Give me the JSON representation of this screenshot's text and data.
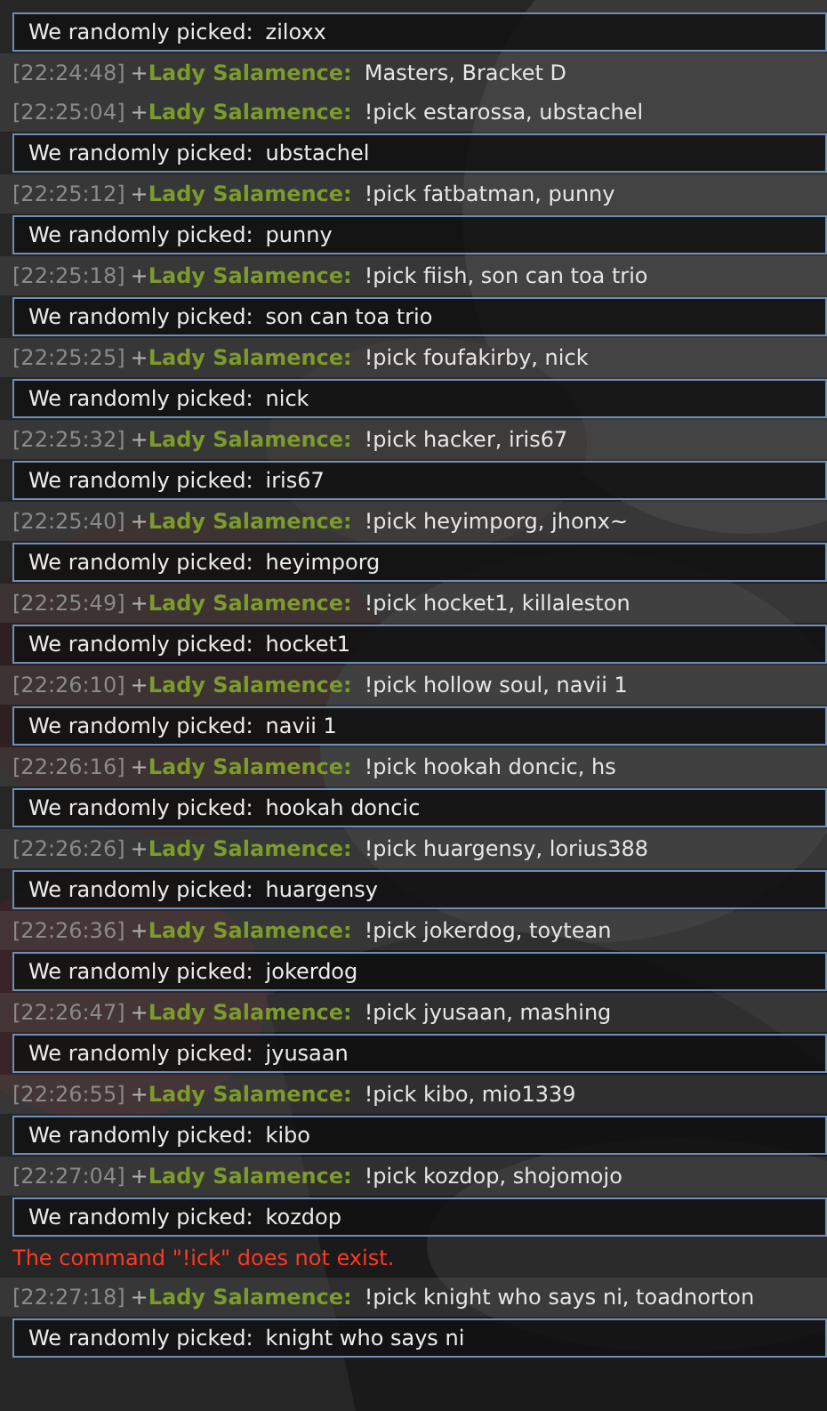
{
  "messages": [
    {
      "kind": "announcement",
      "label": "We randomly picked:",
      "value": "ziloxx"
    },
    {
      "kind": "chat",
      "time": "[22:24:48]",
      "rank": "+",
      "user": "Lady Salamence:",
      "text": "Masters, Bracket D"
    },
    {
      "kind": "chat",
      "time": "[22:25:04]",
      "rank": "+",
      "user": "Lady Salamence:",
      "text": "!pick estarossa, ubstachel"
    },
    {
      "kind": "announcement",
      "label": "We randomly picked:",
      "value": "ubstachel"
    },
    {
      "kind": "chat",
      "time": "[22:25:12]",
      "rank": "+",
      "user": "Lady Salamence:",
      "text": "!pick fatbatman, punny"
    },
    {
      "kind": "announcement",
      "label": "We randomly picked:",
      "value": "punny"
    },
    {
      "kind": "chat",
      "time": "[22:25:18]",
      "rank": "+",
      "user": "Lady Salamence:",
      "text": "!pick fiish, son can toa trio"
    },
    {
      "kind": "announcement",
      "label": "We randomly picked:",
      "value": "son can toa trio"
    },
    {
      "kind": "chat",
      "time": "[22:25:25]",
      "rank": "+",
      "user": "Lady Salamence:",
      "text": "!pick foufakirby, nick"
    },
    {
      "kind": "announcement",
      "label": "We randomly picked:",
      "value": "nick"
    },
    {
      "kind": "chat",
      "time": "[22:25:32]",
      "rank": "+",
      "user": "Lady Salamence:",
      "text": "!pick hacker, iris67"
    },
    {
      "kind": "announcement",
      "label": "We randomly picked:",
      "value": "iris67"
    },
    {
      "kind": "chat",
      "time": "[22:25:40]",
      "rank": "+",
      "user": "Lady Salamence:",
      "text": "!pick heyimporg, jhonx~"
    },
    {
      "kind": "announcement",
      "label": "We randomly picked:",
      "value": "heyimporg"
    },
    {
      "kind": "chat",
      "time": "[22:25:49]",
      "rank": "+",
      "user": "Lady Salamence:",
      "text": "!pick hocket1, killaleston"
    },
    {
      "kind": "announcement",
      "label": "We randomly picked:",
      "value": "hocket1"
    },
    {
      "kind": "chat",
      "time": "[22:26:10]",
      "rank": "+",
      "user": "Lady Salamence:",
      "text": "!pick hollow soul, navii 1"
    },
    {
      "kind": "announcement",
      "label": "We randomly picked:",
      "value": "navii 1"
    },
    {
      "kind": "chat",
      "time": "[22:26:16]",
      "rank": "+",
      "user": "Lady Salamence:",
      "text": "!pick hookah doncic, hs"
    },
    {
      "kind": "announcement",
      "label": "We randomly picked:",
      "value": "hookah doncic"
    },
    {
      "kind": "chat",
      "time": "[22:26:26]",
      "rank": "+",
      "user": "Lady Salamence:",
      "text": "!pick huargensy, lorius388"
    },
    {
      "kind": "announcement",
      "label": "We randomly picked:",
      "value": "huargensy"
    },
    {
      "kind": "chat",
      "time": "[22:26:36]",
      "rank": "+",
      "user": "Lady Salamence:",
      "text": "!pick jokerdog, toytean"
    },
    {
      "kind": "announcement",
      "label": "We randomly picked:",
      "value": "jokerdog"
    },
    {
      "kind": "chat",
      "time": "[22:26:47]",
      "rank": "+",
      "user": "Lady Salamence:",
      "text": "!pick jyusaan, mashing"
    },
    {
      "kind": "announcement",
      "label": "We randomly picked:",
      "value": "jyusaan"
    },
    {
      "kind": "chat",
      "time": "[22:26:55]",
      "rank": "+",
      "user": "Lady Salamence:",
      "text": "!pick kibo, mio1339"
    },
    {
      "kind": "announcement",
      "label": "We randomly picked:",
      "value": "kibo"
    },
    {
      "kind": "chat",
      "time": "[22:27:04]",
      "rank": "+",
      "user": "Lady Salamence:",
      "text": "!pick kozdop, shojomojo"
    },
    {
      "kind": "announcement",
      "label": "We randomly picked:",
      "value": "kozdop"
    },
    {
      "kind": "error",
      "text": "The command \"!ick\" does not exist."
    },
    {
      "kind": "chat",
      "time": "[22:27:18]",
      "rank": "+",
      "user": "Lady Salamence:",
      "text": "!pick knight who says ni, toadnorton"
    },
    {
      "kind": "announcement",
      "label": "We randomly picked:",
      "value": "knight who says ni"
    }
  ]
}
